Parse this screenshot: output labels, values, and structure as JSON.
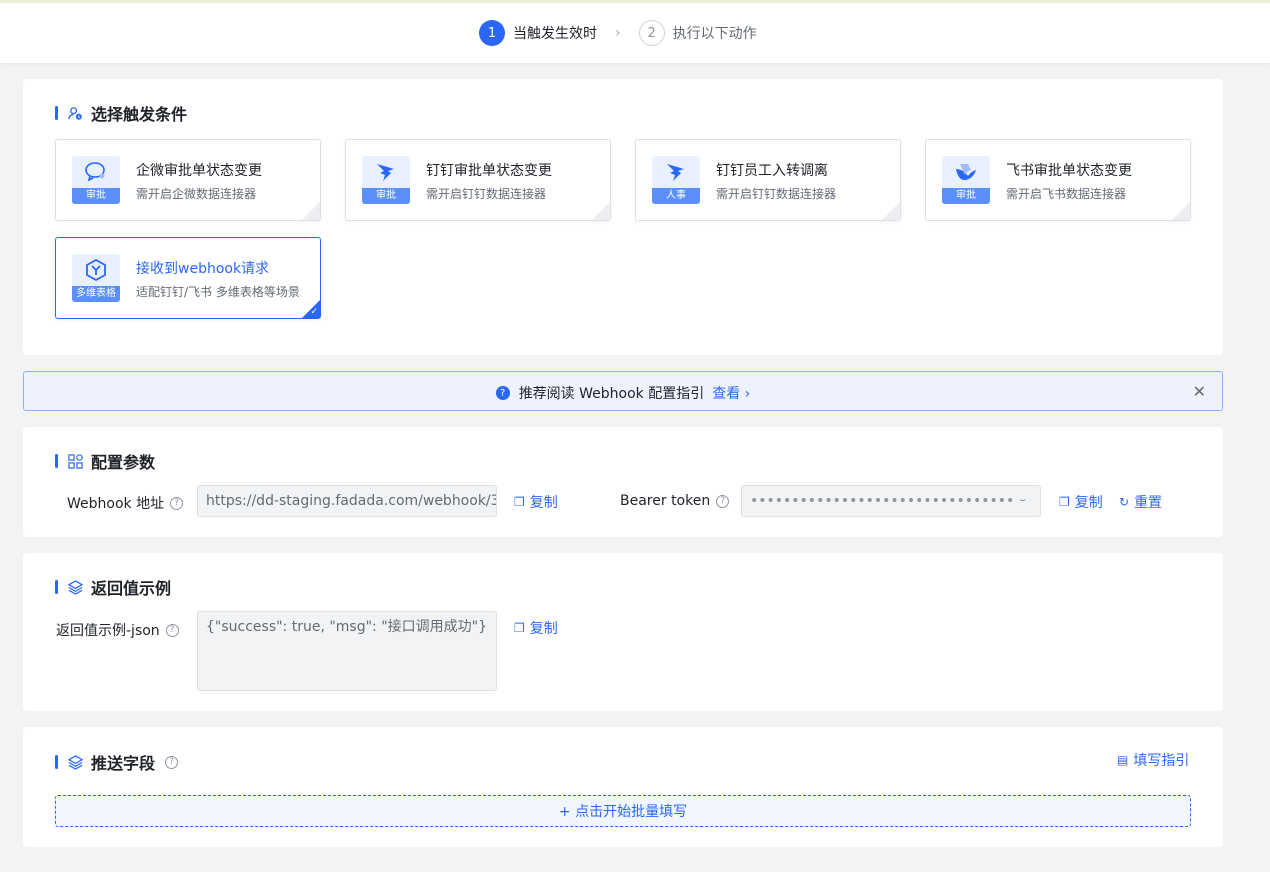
{
  "steps": [
    {
      "num": "1",
      "label": "当触发生效时"
    },
    {
      "num": "2",
      "label": "执行以下动作"
    }
  ],
  "step_separator": "›",
  "trigger_section": {
    "title": "选择触发条件",
    "options": [
      {
        "title": "企微审批单状态变更",
        "desc": "需开启企微数据连接器",
        "tag": "审批",
        "icon": "wecom-chat-icon"
      },
      {
        "title": "钉钉审批单状态变更",
        "desc": "需开启钉钉数据连接器",
        "tag": "审批",
        "icon": "dingtalk-icon"
      },
      {
        "title": "钉钉员工入转调离",
        "desc": "需开启钉钉数据连接器",
        "tag": "人事",
        "icon": "dingtalk-icon"
      },
      {
        "title": "飞书审批单状态变更",
        "desc": "需开启飞书数据连接器",
        "tag": "审批",
        "icon": "feishu-icon"
      },
      {
        "title": "接收到webhook请求",
        "desc": "适配钉钉/飞书 多维表格等场景",
        "tag": "多维表格",
        "icon": "webhook-cube-icon",
        "selected": true
      }
    ]
  },
  "notice": {
    "text": "推荐阅读 Webhook 配置指引",
    "link": "查看 ›",
    "close": "✕",
    "qmark": "?"
  },
  "config_section": {
    "title": "配置参数",
    "webhook_label": "Webhook 地址",
    "webhook_value": "https://dd-staging.fadada.com/webhook/3",
    "copy": "复制",
    "token_label": "Bearer token",
    "token_value": "••••••••••••••••••••••••••••••••",
    "reset": "重置"
  },
  "return_section": {
    "title": "返回值示例",
    "label": "返回值示例-json",
    "value": "{\"success\": true, \"msg\": \"接口调用成功\"}",
    "copy": "复制"
  },
  "push_section": {
    "title": "推送字段",
    "guide": "填写指引",
    "batch": "+   点击开始批量填写"
  },
  "help_glyph": "?",
  "colors": {
    "accent": "#2b67f6",
    "tag": "#5b8ff9",
    "notice_bg": "#edf2fe"
  }
}
